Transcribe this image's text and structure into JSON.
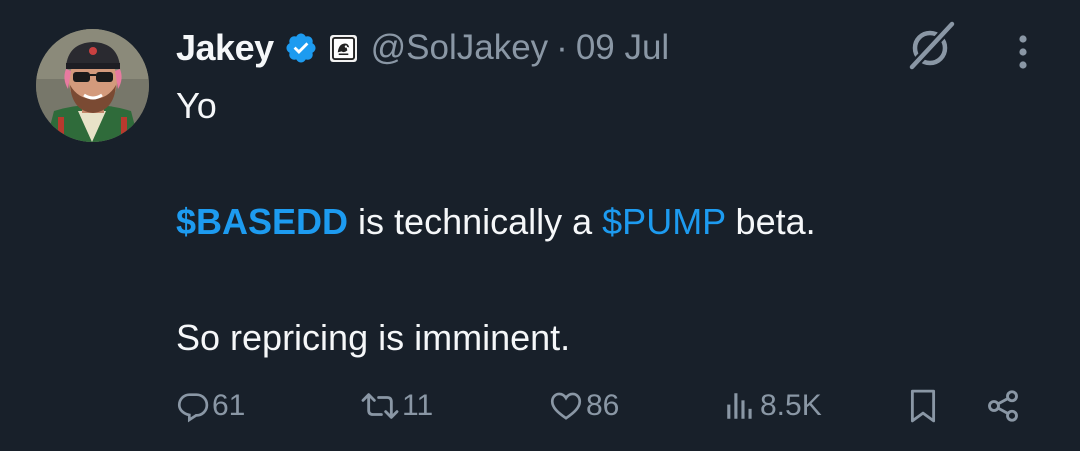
{
  "tweet": {
    "author_name": "Jakey",
    "handle": "@SolJakey",
    "separator": "·",
    "date": "09 Jul",
    "body": {
      "line1": "Yo",
      "line2": {
        "cashtag1": "$BASEDD",
        "text1": " is technically a ",
        "cashtag2": "$PUMP",
        "text2": " beta."
      },
      "line3": "So repricing is imminent."
    },
    "actions": {
      "replies": "61",
      "reposts": "11",
      "likes": "86",
      "views": "8.5K"
    }
  },
  "colors": {
    "background": "#18202a",
    "text": "#f5f7f9",
    "secondary": "#8a97a5",
    "accent": "#1d9bf0"
  },
  "icons": {
    "verified": "verified-badge-icon",
    "affiliate": "affiliate-badge-icon",
    "grok": "grok-icon",
    "more": "more-options-icon",
    "reply": "reply-icon",
    "repost": "repost-icon",
    "like": "like-icon",
    "views": "views-icon",
    "bookmark": "bookmark-icon",
    "share": "share-icon"
  }
}
